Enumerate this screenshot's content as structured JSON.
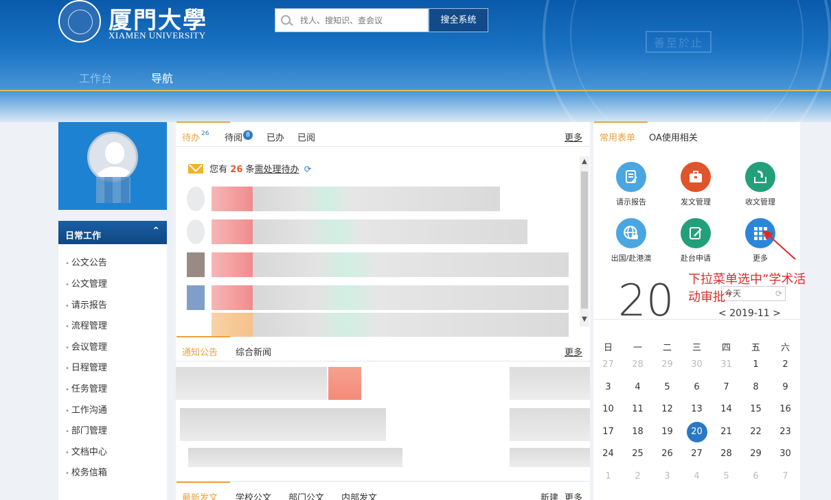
{
  "header": {
    "logo_cn": "厦門大學",
    "logo_en": "XIAMEN UNIVERSITY",
    "seal_motto": "善至於止",
    "search_placeholder": "找人、搜知识、查会议",
    "search_button": "搜全系统",
    "nav": [
      "工作台",
      "导航"
    ]
  },
  "sidebar": {
    "section_title": "日常工作",
    "items": [
      "公文公告",
      "公文管理",
      "请示报告",
      "流程管理",
      "会议管理",
      "日程管理",
      "任务管理",
      "工作沟通",
      "部门管理",
      "文档中心",
      "校务信箱"
    ]
  },
  "tasks_panel": {
    "tabs": [
      {
        "label": "待办",
        "count": "26"
      },
      {
        "label": "待阅",
        "count": "8"
      },
      {
        "label": "已办"
      },
      {
        "label": "已阅"
      }
    ],
    "more": "更多",
    "notice_prefix": "您有",
    "notice_count": "26",
    "notice_mid": "条",
    "notice_link": "需处理待办"
  },
  "news_panel": {
    "tabs": [
      "通知公告",
      "综合新闻"
    ],
    "more": "更多"
  },
  "docs_panel": {
    "tabs": [
      "最新发文",
      "学校公文",
      "部门公文",
      "内部发文"
    ],
    "new": "新建",
    "more": "更多"
  },
  "forms_panel": {
    "tabs": [
      "常用表单",
      "OA使用相关"
    ],
    "apps": [
      {
        "label": "请示报告",
        "icon": "report-icon",
        "color": "#4aa6e0"
      },
      {
        "label": "发文管理",
        "icon": "briefcase-icon",
        "color": "#e0542b"
      },
      {
        "label": "收文管理",
        "icon": "inbox-icon",
        "color": "#22a07a"
      },
      {
        "label": "出国/赴港澳",
        "icon": "globe-icon",
        "color": "#4aa6e0"
      },
      {
        "label": "赴台申请",
        "icon": "edit-icon",
        "color": "#22a07a"
      },
      {
        "label": "更多",
        "icon": "grid-icon",
        "color": "#2b86d9"
      }
    ],
    "annotation": "下拉菜单选中”学术活动审批”"
  },
  "calendar": {
    "big_day": "20",
    "today_label": "今天",
    "month_label": "2019-11",
    "weekdays": [
      "日",
      "一",
      "二",
      "三",
      "四",
      "五",
      "六"
    ],
    "weeks": [
      [
        "27",
        "28",
        "29",
        "30",
        "31",
        "1",
        "2"
      ],
      [
        "3",
        "4",
        "5",
        "6",
        "7",
        "8",
        "9"
      ],
      [
        "10",
        "11",
        "12",
        "13",
        "14",
        "15",
        "16"
      ],
      [
        "17",
        "18",
        "19",
        "20",
        "21",
        "22",
        "23"
      ],
      [
        "24",
        "25",
        "26",
        "27",
        "28",
        "29",
        "30"
      ],
      [
        "1",
        "2",
        "3",
        "4",
        "5",
        "6",
        "7"
      ]
    ],
    "today": "20"
  }
}
